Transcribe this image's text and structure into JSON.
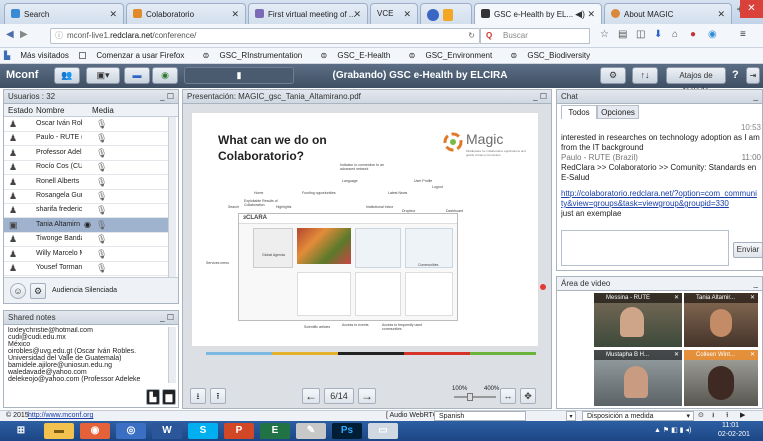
{
  "browser": {
    "tabs": [
      {
        "label": "Search"
      },
      {
        "label": "Colaboratorio"
      },
      {
        "label": "First virtual meeting of ..."
      },
      {
        "label": "VCE"
      },
      {
        "label": ""
      },
      {
        "label": "GSC e-Health by EL..."
      },
      {
        "label": "About MAGIC"
      }
    ],
    "url_prefix": "mconf-live1.",
    "url_domain": "redclara.net",
    "url_path": "/conference/",
    "search_placeholder": "Buscar",
    "bookmarks": [
      "Más visitados",
      "Comenzar a usar Firefox",
      "GSC_RInstrumentation",
      "GSC_E-Health",
      "GSC_Environment",
      "GSC_Biodiversity"
    ]
  },
  "app": {
    "logo": "Mconf",
    "title": "(Grabando) GSC e-Health by ELCIRA",
    "keyboard_shortcuts": "Atajos de teclado",
    "help": "?"
  },
  "users": {
    "title": "Usuarios : 32",
    "columns": [
      "Estado",
      "Nombre",
      "Media"
    ],
    "rows": [
      {
        "name": "Oscar Iván Rob"
      },
      {
        "name": "Paulo - RUTE (B"
      },
      {
        "name": "Professor Adel"
      },
      {
        "name": "Rocío Cos (CUD"
      },
      {
        "name": "Ronell Alberts"
      },
      {
        "name": "Rosangela Gun"
      },
      {
        "name": "sharifa frederic"
      },
      {
        "name": "Tania Altamirn"
      },
      {
        "name": "Tiwonge Banda"
      },
      {
        "name": "Willy Marcelo M"
      },
      {
        "name": "Yousef Torman"
      }
    ],
    "silenced_label": "Audiencia Silenciada"
  },
  "notes": {
    "title": "Shared notes",
    "lines": [
      "loxleychristie@hotmail.com",
      "cudi@cudi.edu.mx",
      "México",
      "oirobles@uvg.edu.gt (Oscar Iván Robles.",
      "Universidad del Valle de Guatemala)",
      "bamidele.ajilore@uniosun.edu.ng",
      "waledavade@yahoo.com",
      "delekeojo@yahoo.com (Professor Adeleke"
    ]
  },
  "presentation": {
    "title": "Presentación: MAGIC_gsc_Tania_Altamirano.pdf",
    "slide_heading_1": "What can we do on",
    "slide_heading_2": "Colaboratorio?",
    "magic_logo": "Magic",
    "magic_tagline": "Middleware for collaborative applications and global virtual communities",
    "labels": [
      "Home",
      "Funding opportunities",
      "Language",
      "User Profile",
      "Logout",
      "Latest News",
      "Indicator to connection to an advanced network",
      "Services menu",
      "Exploitable Results of Collaboration",
      "Dropbox",
      "Global Agenda",
      "Communities",
      "Search",
      "Highlights",
      "Institutional Inbox",
      "Dashboard",
      "Access to events",
      "Access to frequently used communities",
      "Scientific articles"
    ],
    "page": "6/14",
    "zoom_min": "100%",
    "zoom_max": "400%",
    "zoom_level": 0.35
  },
  "chat": {
    "title": "Chat",
    "tabs": [
      "Todos",
      "Opciones"
    ],
    "time_1": "10:53",
    "msg_1": "interested in researches on technology adoption as I am from the IT background",
    "sender_2": "Paulo - RUTE (Brazil)",
    "time_2": "11:00",
    "msg_2": "RedClara >> Colaboratorio >> Comunity: Standards en E-Salud",
    "link": "http://colaboratorio.redclara.net/?option=com_community&view=groups&task=viewgroup&groupid=330",
    "link_line_1": "http://colaboratorio.redclara.net/?option=com_communi",
    "link_line_2": "ty&view=groups&task=viewgroup&groupid=330",
    "msg_3": "just an exemplae",
    "send": "Enviar"
  },
  "video": {
    "title": "Área de video",
    "tiles": [
      {
        "name": "Messina - RUTE"
      },
      {
        "name": "Tania Altamir..."
      },
      {
        "name": "Mustapha B H..."
      },
      {
        "name": "Colleen Wint..."
      }
    ]
  },
  "footer": {
    "copyright_prefix": "© 2015",
    "copyright_link": "http://www.mconf.org",
    "audio": "[ Audio WebRTC ]",
    "language": "Spanish",
    "layout": "Disposición a medida"
  },
  "taskbar": {
    "clock": "11:01",
    "date": "02-02-201"
  },
  "colors": {
    "app_header": "#4a5b70",
    "selected_row": "#9fb3cf",
    "taskbar": "#1f4f8f",
    "recording_dot": "#e53935"
  }
}
